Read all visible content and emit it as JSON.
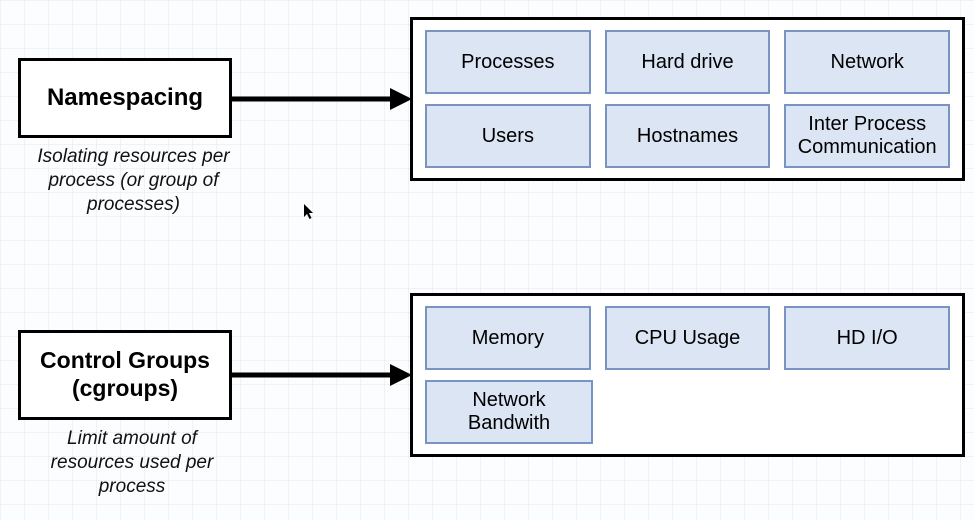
{
  "namespacing": {
    "title": "Namespacing",
    "caption": "Isolating resources per process (or group of processes)",
    "items": [
      [
        "Processes",
        "Hard drive",
        "Network"
      ],
      [
        "Users",
        "Hostnames",
        "Inter Process Communication"
      ]
    ]
  },
  "cgroups": {
    "title": "Control Groups (cgroups)",
    "caption": "Limit amount of resources used per process",
    "items": [
      [
        "Memory",
        "CPU Usage",
        "HD I/O"
      ],
      [
        "Network Bandwith"
      ]
    ]
  }
}
